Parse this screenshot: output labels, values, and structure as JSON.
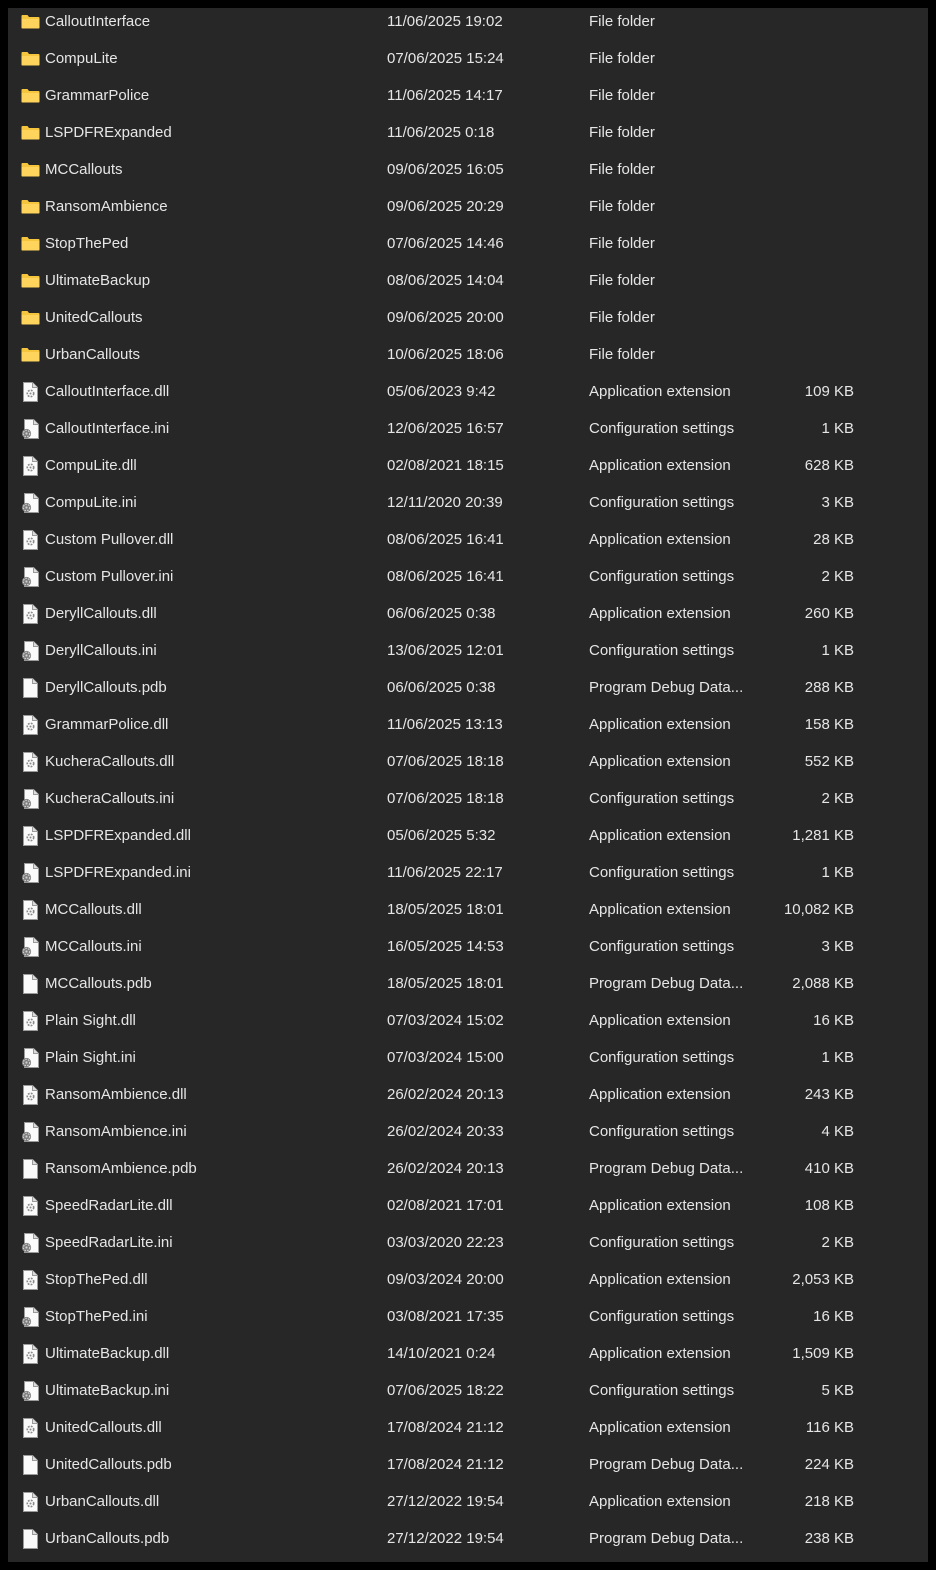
{
  "colors": {
    "background": "#272727",
    "text": "#e6e6e6",
    "folder": "#f5c53d"
  },
  "files": [
    {
      "name": "CalloutInterface",
      "date": "11/06/2025 19:02",
      "type": "File folder",
      "size": "",
      "icon": "folder-icon"
    },
    {
      "name": "CompuLite",
      "date": "07/06/2025 15:24",
      "type": "File folder",
      "size": "",
      "icon": "folder-icon"
    },
    {
      "name": "GrammarPolice",
      "date": "11/06/2025 14:17",
      "type": "File folder",
      "size": "",
      "icon": "folder-icon"
    },
    {
      "name": "LSPDFRExpanded",
      "date": "11/06/2025 0:18",
      "type": "File folder",
      "size": "",
      "icon": "folder-icon"
    },
    {
      "name": "MCCallouts",
      "date": "09/06/2025 16:05",
      "type": "File folder",
      "size": "",
      "icon": "folder-icon"
    },
    {
      "name": "RansomAmbience",
      "date": "09/06/2025 20:29",
      "type": "File folder",
      "size": "",
      "icon": "folder-icon"
    },
    {
      "name": "StopThePed",
      "date": "07/06/2025 14:46",
      "type": "File folder",
      "size": "",
      "icon": "folder-icon"
    },
    {
      "name": "UltimateBackup",
      "date": "08/06/2025 14:04",
      "type": "File folder",
      "size": "",
      "icon": "folder-icon"
    },
    {
      "name": "UnitedCallouts",
      "date": "09/06/2025 20:00",
      "type": "File folder",
      "size": "",
      "icon": "folder-icon"
    },
    {
      "name": "UrbanCallouts",
      "date": "10/06/2025 18:06",
      "type": "File folder",
      "size": "",
      "icon": "folder-icon"
    },
    {
      "name": "CalloutInterface.dll",
      "date": "05/06/2023 9:42",
      "type": "Application extension",
      "size": "109 KB",
      "icon": "dll-file-icon"
    },
    {
      "name": "CalloutInterface.ini",
      "date": "12/06/2025 16:57",
      "type": "Configuration settings",
      "size": "1 KB",
      "icon": "ini-file-icon"
    },
    {
      "name": "CompuLite.dll",
      "date": "02/08/2021 18:15",
      "type": "Application extension",
      "size": "628 KB",
      "icon": "dll-file-icon"
    },
    {
      "name": "CompuLite.ini",
      "date": "12/11/2020 20:39",
      "type": "Configuration settings",
      "size": "3 KB",
      "icon": "ini-file-icon"
    },
    {
      "name": "Custom Pullover.dll",
      "date": "08/06/2025 16:41",
      "type": "Application extension",
      "size": "28 KB",
      "icon": "dll-file-icon"
    },
    {
      "name": "Custom Pullover.ini",
      "date": "08/06/2025 16:41",
      "type": "Configuration settings",
      "size": "2 KB",
      "icon": "ini-file-icon"
    },
    {
      "name": "DeryllCallouts.dll",
      "date": "06/06/2025 0:38",
      "type": "Application extension",
      "size": "260 KB",
      "icon": "dll-file-icon"
    },
    {
      "name": "DeryllCallouts.ini",
      "date": "13/06/2025 12:01",
      "type": "Configuration settings",
      "size": "1 KB",
      "icon": "ini-file-icon"
    },
    {
      "name": "DeryllCallouts.pdb",
      "date": "06/06/2025 0:38",
      "type": "Program Debug Data...",
      "size": "288 KB",
      "icon": "blank-file-icon"
    },
    {
      "name": "GrammarPolice.dll",
      "date": "11/06/2025 13:13",
      "type": "Application extension",
      "size": "158 KB",
      "icon": "dll-file-icon"
    },
    {
      "name": "KucheraCallouts.dll",
      "date": "07/06/2025 18:18",
      "type": "Application extension",
      "size": "552 KB",
      "icon": "dll-file-icon"
    },
    {
      "name": "KucheraCallouts.ini",
      "date": "07/06/2025 18:18",
      "type": "Configuration settings",
      "size": "2 KB",
      "icon": "ini-file-icon"
    },
    {
      "name": "LSPDFRExpanded.dll",
      "date": "05/06/2025 5:32",
      "type": "Application extension",
      "size": "1,281 KB",
      "icon": "dll-file-icon"
    },
    {
      "name": "LSPDFRExpanded.ini",
      "date": "11/06/2025 22:17",
      "type": "Configuration settings",
      "size": "1 KB",
      "icon": "ini-file-icon"
    },
    {
      "name": "MCCallouts.dll",
      "date": "18/05/2025 18:01",
      "type": "Application extension",
      "size": "10,082 KB",
      "icon": "dll-file-icon"
    },
    {
      "name": "MCCallouts.ini",
      "date": "16/05/2025 14:53",
      "type": "Configuration settings",
      "size": "3 KB",
      "icon": "ini-file-icon"
    },
    {
      "name": "MCCallouts.pdb",
      "date": "18/05/2025 18:01",
      "type": "Program Debug Data...",
      "size": "2,088 KB",
      "icon": "blank-file-icon"
    },
    {
      "name": "Plain Sight.dll",
      "date": "07/03/2024 15:02",
      "type": "Application extension",
      "size": "16 KB",
      "icon": "dll-file-icon"
    },
    {
      "name": "Plain Sight.ini",
      "date": "07/03/2024 15:00",
      "type": "Configuration settings",
      "size": "1 KB",
      "icon": "ini-file-icon"
    },
    {
      "name": "RansomAmbience.dll",
      "date": "26/02/2024 20:13",
      "type": "Application extension",
      "size": "243 KB",
      "icon": "dll-file-icon"
    },
    {
      "name": "RansomAmbience.ini",
      "date": "26/02/2024 20:33",
      "type": "Configuration settings",
      "size": "4 KB",
      "icon": "ini-file-icon"
    },
    {
      "name": "RansomAmbience.pdb",
      "date": "26/02/2024 20:13",
      "type": "Program Debug Data...",
      "size": "410 KB",
      "icon": "blank-file-icon"
    },
    {
      "name": "SpeedRadarLite.dll",
      "date": "02/08/2021 17:01",
      "type": "Application extension",
      "size": "108 KB",
      "icon": "dll-file-icon"
    },
    {
      "name": "SpeedRadarLite.ini",
      "date": "03/03/2020 22:23",
      "type": "Configuration settings",
      "size": "2 KB",
      "icon": "ini-file-icon"
    },
    {
      "name": "StopThePed.dll",
      "date": "09/03/2024 20:00",
      "type": "Application extension",
      "size": "2,053 KB",
      "icon": "dll-file-icon"
    },
    {
      "name": "StopThePed.ini",
      "date": "03/08/2021 17:35",
      "type": "Configuration settings",
      "size": "16 KB",
      "icon": "ini-file-icon"
    },
    {
      "name": "UltimateBackup.dll",
      "date": "14/10/2021 0:24",
      "type": "Application extension",
      "size": "1,509 KB",
      "icon": "dll-file-icon"
    },
    {
      "name": "UltimateBackup.ini",
      "date": "07/06/2025 18:22",
      "type": "Configuration settings",
      "size": "5 KB",
      "icon": "ini-file-icon"
    },
    {
      "name": "UnitedCallouts.dll",
      "date": "17/08/2024 21:12",
      "type": "Application extension",
      "size": "116 KB",
      "icon": "dll-file-icon"
    },
    {
      "name": "UnitedCallouts.pdb",
      "date": "17/08/2024 21:12",
      "type": "Program Debug Data...",
      "size": "224 KB",
      "icon": "blank-file-icon"
    },
    {
      "name": "UrbanCallouts.dll",
      "date": "27/12/2022 19:54",
      "type": "Application extension",
      "size": "218 KB",
      "icon": "dll-file-icon"
    },
    {
      "name": "UrbanCallouts.pdb",
      "date": "27/12/2022 19:54",
      "type": "Program Debug Data...",
      "size": "238 KB",
      "icon": "blank-file-icon"
    }
  ]
}
